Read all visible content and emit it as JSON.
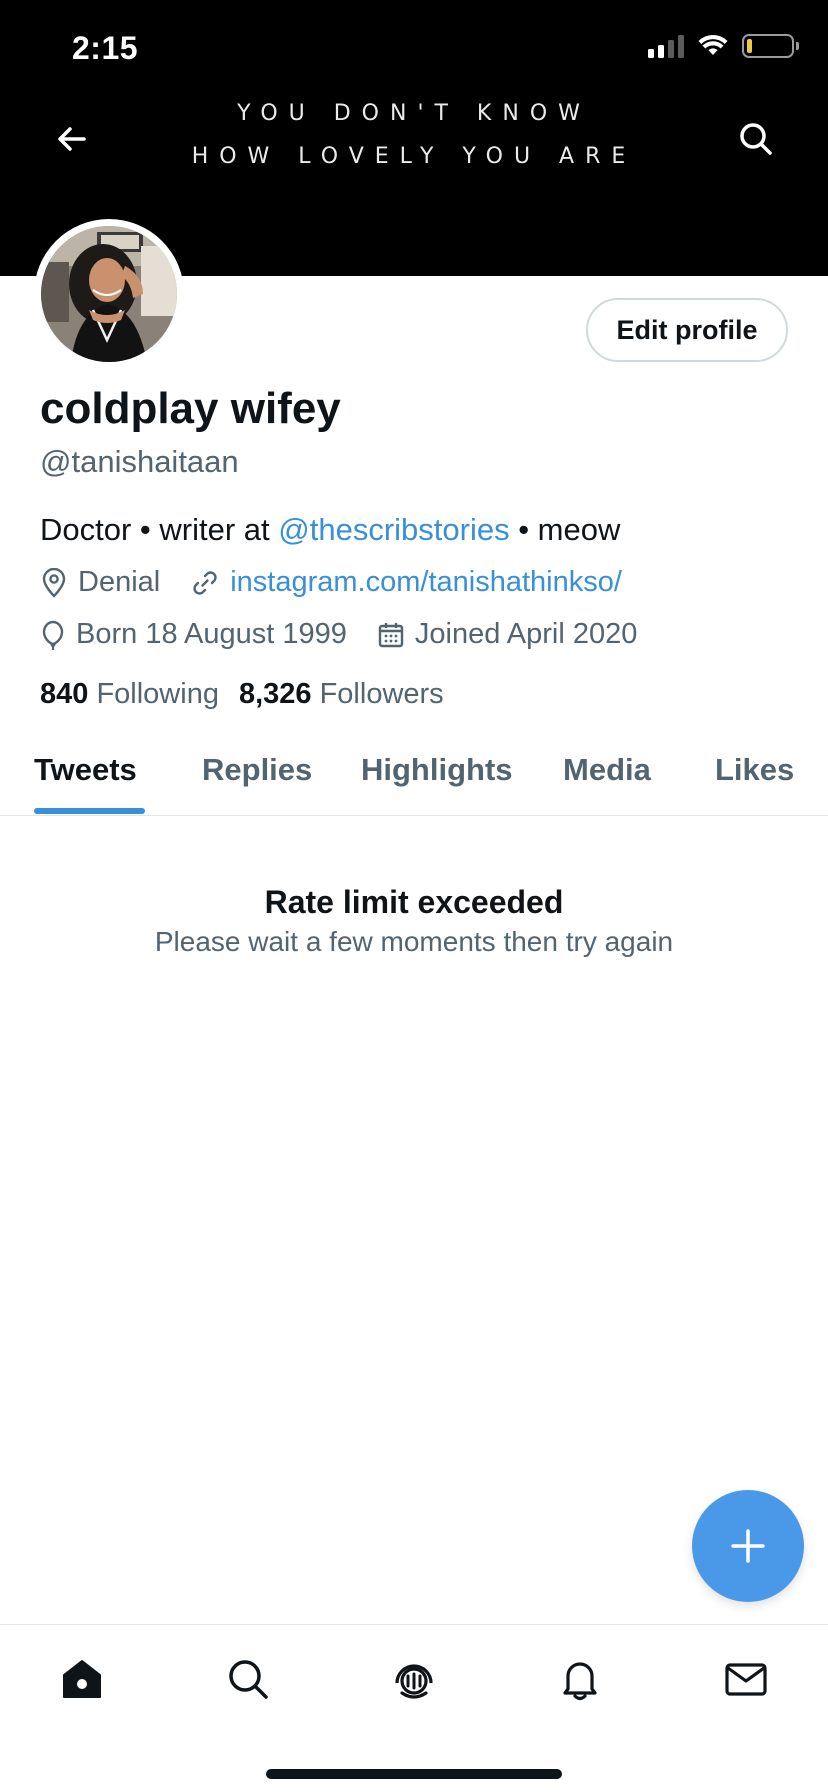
{
  "status_bar": {
    "time": "2:15",
    "battery_percent": 8
  },
  "banner": {
    "line1": "YOU DON'T KNOW",
    "line2": "HOW LOVELY YOU ARE"
  },
  "profile": {
    "edit_label": "Edit profile",
    "display_name": "coldplay wifey",
    "handle": "@tanishaitaan",
    "bio": {
      "prefix": "Doctor • writer at ",
      "mention": "@thescribstories",
      "suffix": " • meow"
    },
    "location": "Denial",
    "website": "instagram.com/tanishathinkso/",
    "born": "Born 18 August 1999",
    "joined": "Joined April 2020",
    "following_count": "840",
    "following_label": "Following",
    "followers_count": "8,326",
    "followers_label": "Followers"
  },
  "tabs": [
    {
      "label": "Tweets",
      "active": true
    },
    {
      "label": "Replies",
      "active": false
    },
    {
      "label": "Highlights",
      "active": false
    },
    {
      "label": "Media",
      "active": false
    },
    {
      "label": "Likes",
      "active": false
    }
  ],
  "error": {
    "title": "Rate limit exceeded",
    "subtitle": "Please wait a few moments then try again"
  },
  "bottom_nav": {
    "items": [
      "home-icon",
      "search-icon",
      "spaces-icon",
      "notifications-icon",
      "messages-icon"
    ]
  },
  "colors": {
    "accent": "#3a8fd9",
    "fab": "#4a99e9",
    "muted": "#536471",
    "text": "#0f1419"
  }
}
